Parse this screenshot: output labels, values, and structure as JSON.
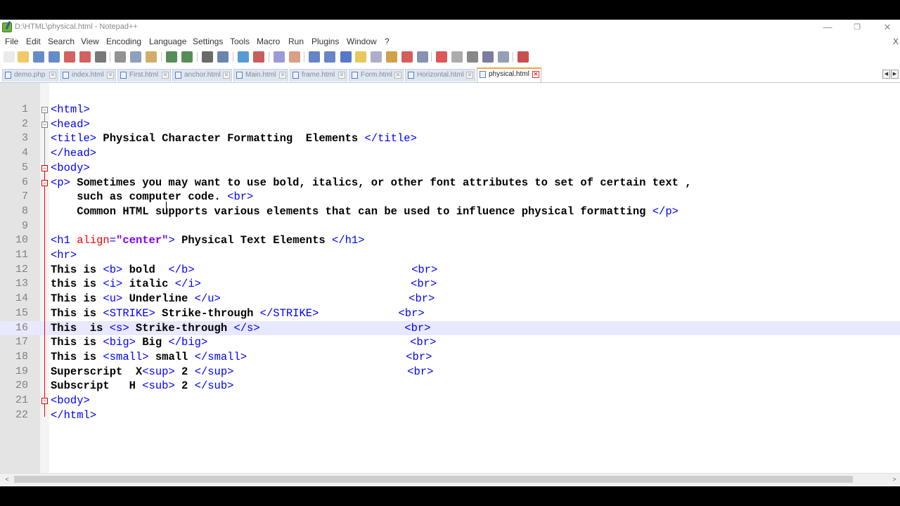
{
  "window": {
    "title": "D:\\HTML\\physical.html - Notepad++",
    "min_glyph": "—",
    "max_glyph": "❐",
    "close_glyph": "✕"
  },
  "menu": [
    "File",
    "Edit",
    "Search",
    "View",
    "Encoding",
    "Language",
    "Settings",
    "Tools",
    "Macro",
    "Run",
    "Plugins",
    "Window",
    "?"
  ],
  "menu_close": "X",
  "toolbar_icons": [
    "new-file-icon",
    "open-file-icon",
    "save-icon",
    "save-all-icon",
    "close-icon",
    "close-all-icon",
    "print-icon",
    "cut-icon",
    "copy-icon",
    "paste-icon",
    "undo-icon",
    "redo-icon",
    "find-icon",
    "replace-icon",
    "zoom-in-icon",
    "zoom-out-icon",
    "sync-vertical-icon",
    "sync-horizontal-icon",
    "word-wrap-icon",
    "show-all-chars-icon",
    "indent-guide-icon",
    "udl-icon",
    "doc-map-icon",
    "function-list-icon",
    "folder-workspace-icon",
    "monitor-icon",
    "record-macro-icon",
    "stop-record-icon",
    "play-macro-icon",
    "run-multiple-icon",
    "save-macro-icon",
    "spellcheck-icon"
  ],
  "tabs": [
    {
      "label": "demo.php",
      "active": false
    },
    {
      "label": "index.html",
      "active": false
    },
    {
      "label": "First.html",
      "active": false
    },
    {
      "label": "anchor.html",
      "active": false
    },
    {
      "label": "Main.html",
      "active": false
    },
    {
      "label": "frame.html",
      "active": false
    },
    {
      "label": "Form.html",
      "active": false
    },
    {
      "label": "Horizontal.html",
      "active": false
    },
    {
      "label": "physical.html",
      "active": true
    }
  ],
  "tab_close_glyph": "✕",
  "editor": {
    "current_line": 16,
    "lines": [
      {
        "n": "1",
        "segs": [
          [
            "t",
            "<html>"
          ]
        ]
      },
      {
        "n": "2",
        "segs": [
          [
            "t",
            "<head>"
          ]
        ]
      },
      {
        "n": "3",
        "segs": [
          [
            "t",
            "<title>"
          ],
          [
            "x",
            " Physical Character Formatting  Elements "
          ],
          [
            "t",
            "</title>"
          ]
        ]
      },
      {
        "n": "4",
        "segs": [
          [
            "t",
            "</head>"
          ]
        ]
      },
      {
        "n": "5",
        "segs": [
          [
            "t",
            "<body>"
          ]
        ]
      },
      {
        "n": "6",
        "segs": [
          [
            "t",
            "<p>"
          ],
          [
            "x",
            " Sometimes you may want to use bold, italics, or other font attributes to set of certain text ,"
          ]
        ]
      },
      {
        "n": "7",
        "segs": [
          [
            "x",
            "    such as computer code. "
          ],
          [
            "t",
            "<br>"
          ]
        ]
      },
      {
        "n": "8",
        "segs": [
          [
            "x",
            "    Common HTML supports various elements that can be used to influence physical formatting "
          ],
          [
            "t",
            "</p>"
          ]
        ]
      },
      {
        "n": "9",
        "segs": []
      },
      {
        "n": "10",
        "segs": [
          [
            "t",
            "<h1 "
          ],
          [
            "a",
            "align"
          ],
          [
            "t",
            "="
          ],
          [
            "v",
            "\"center\""
          ],
          [
            "t",
            ">"
          ],
          [
            "x",
            " Physical Text Elements "
          ],
          [
            "t",
            "</h1>"
          ]
        ]
      },
      {
        "n": "11",
        "segs": [
          [
            "t",
            "<hr>"
          ]
        ]
      },
      {
        "n": "12",
        "segs": [
          [
            "x",
            "This is "
          ],
          [
            "t",
            "<b>"
          ],
          [
            "x",
            " bold  "
          ],
          [
            "t",
            "</b>"
          ],
          [
            "p",
            "30"
          ],
          [
            "t",
            "<br>"
          ]
        ]
      },
      {
        "n": "13",
        "segs": [
          [
            "x",
            "this is "
          ],
          [
            "t",
            "<i>"
          ],
          [
            "x",
            " italic "
          ],
          [
            "t",
            "</i>"
          ],
          [
            "p",
            "29"
          ],
          [
            "t",
            "<br>"
          ]
        ]
      },
      {
        "n": "14",
        "segs": [
          [
            "x",
            "This is "
          ],
          [
            "t",
            "<u>"
          ],
          [
            "x",
            " Underline "
          ],
          [
            "t",
            "</u>"
          ],
          [
            "p",
            "26"
          ],
          [
            "t",
            "<br>"
          ]
        ]
      },
      {
        "n": "15",
        "segs": [
          [
            "x",
            "This is "
          ],
          [
            "t",
            "<STRIKE>"
          ],
          [
            "x",
            " Strike-through "
          ],
          [
            "t",
            "</STRIKE>"
          ],
          [
            "p",
            "11"
          ],
          [
            "t",
            "<br>"
          ]
        ]
      },
      {
        "n": "16",
        "segs": [
          [
            "x",
            "This  is "
          ],
          [
            "t",
            "<s>"
          ],
          [
            "x",
            " Strike-through "
          ],
          [
            "t",
            "</s>"
          ],
          [
            "p",
            "20"
          ],
          [
            "t",
            "<br>"
          ]
        ]
      },
      {
        "n": "17",
        "segs": [
          [
            "x",
            "This is "
          ],
          [
            "t",
            "<big>"
          ],
          [
            "x",
            " Big "
          ],
          [
            "t",
            "</big>"
          ],
          [
            "p",
            "28"
          ],
          [
            "t",
            "<br>"
          ]
        ]
      },
      {
        "n": "18",
        "segs": [
          [
            "x",
            "This is "
          ],
          [
            "t",
            "<small>"
          ],
          [
            "x",
            " small "
          ],
          [
            "t",
            "</small>"
          ],
          [
            "p",
            "22"
          ],
          [
            "t",
            "<br>"
          ]
        ]
      },
      {
        "n": "19",
        "segs": [
          [
            "x",
            "Superscript  X"
          ],
          [
            "t",
            "<sup>"
          ],
          [
            "x",
            " 2 "
          ],
          [
            "t",
            "</sup>"
          ],
          [
            "p",
            "24"
          ],
          [
            "t",
            "<br>"
          ]
        ]
      },
      {
        "n": "20",
        "segs": [
          [
            "x",
            "Subscript   H "
          ],
          [
            "t",
            "<sub>"
          ],
          [
            "x",
            " 2 "
          ],
          [
            "t",
            "</sub>"
          ]
        ]
      },
      {
        "n": "21",
        "segs": [
          [
            "t",
            "<body>"
          ]
        ]
      },
      {
        "n": "22",
        "segs": [
          [
            "t",
            "</html>"
          ]
        ]
      }
    ]
  },
  "scroll": {
    "left_glyph": "<",
    "right_glyph": ">"
  },
  "tab_nav": {
    "left_glyph": "◀",
    "right_glyph": "▶"
  }
}
